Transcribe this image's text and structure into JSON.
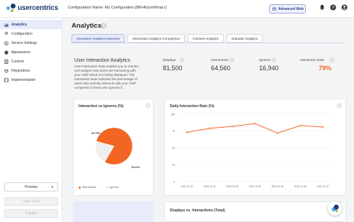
{
  "header": {
    "logo_text": "usercentrics",
    "config_label": "Configuration Name: My Configuration [BKHFpzxWmaLr]",
    "advanced_web_label": "Advanced Web"
  },
  "sidebar": {
    "items": [
      {
        "label": "Analytics",
        "icon": "chart-icon"
      },
      {
        "label": "Configuration",
        "icon": "gear-icon"
      },
      {
        "label": "Service Settings",
        "icon": "sliders-icon"
      },
      {
        "label": "Appearance",
        "icon": "palette-icon"
      },
      {
        "label": "Content",
        "icon": "document-icon"
      },
      {
        "label": "Integrations",
        "icon": "plug-icon"
      },
      {
        "label": "Implementation",
        "icon": "code-icon"
      }
    ],
    "preview_label": "Preview",
    "save_draft_label": "Save Draft",
    "publish_label": "Publish"
  },
  "main": {
    "title": "Analytics",
    "tabs": [
      "Interaction Analytics Overview",
      "Interaction Analytics Comparison",
      "Consent Analytics",
      "Granular Analytics"
    ],
    "summary": {
      "title": "User Interaction Analytics",
      "description": "User Interaction Data enables you to monitor and analyze how users are interacting with your CMP which it is being displayed. The Interaction Rate indicates the percentage of users who actively interacts with your CMP compared to those who ignores it."
    },
    "kpis": [
      {
        "label": "Displays",
        "value": "81,500"
      },
      {
        "label": "Interactions",
        "value": "64,560"
      },
      {
        "label": "Ignores",
        "value": "16,940"
      },
      {
        "label": "Interaction Rate",
        "value": "79%"
      }
    ],
    "pie_card": {
      "title": "Interaction vs Ignores (%)",
      "legend": [
        "Interactions",
        "Ignores"
      ]
    },
    "line_card": {
      "title": "Daily Interaction Rate (%)"
    },
    "bottom_card": {
      "title": "Displays vs. Interactions (Total)"
    }
  },
  "colors": {
    "accent_orange": "#f26522",
    "brand_blue": "#2f3e8f",
    "ignores_gray": "#eeeeee"
  },
  "chart_data": [
    {
      "type": "pie",
      "title": "Interaction vs Ignores (%)",
      "categories": [
        "Interactions",
        "Ignores"
      ],
      "values": [
        79.21,
        20.79
      ],
      "labels": [
        "79.21%",
        "20.79%"
      ],
      "legend": "bottom-left"
    },
    {
      "type": "line",
      "title": "Daily Interaction Rate (%)",
      "x": [
        "2022-11-01",
        "2022-11-02",
        "2022-11-03",
        "2022-11-04",
        "2022-11-05",
        "2022-11-06",
        "2022-11-07"
      ],
      "y_ticks": [
        "0",
        "25",
        "50",
        "75",
        "100"
      ],
      "ylim": [
        0,
        100
      ],
      "values": [
        73,
        79,
        82,
        86,
        72,
        83,
        81
      ],
      "grid": true
    }
  ]
}
